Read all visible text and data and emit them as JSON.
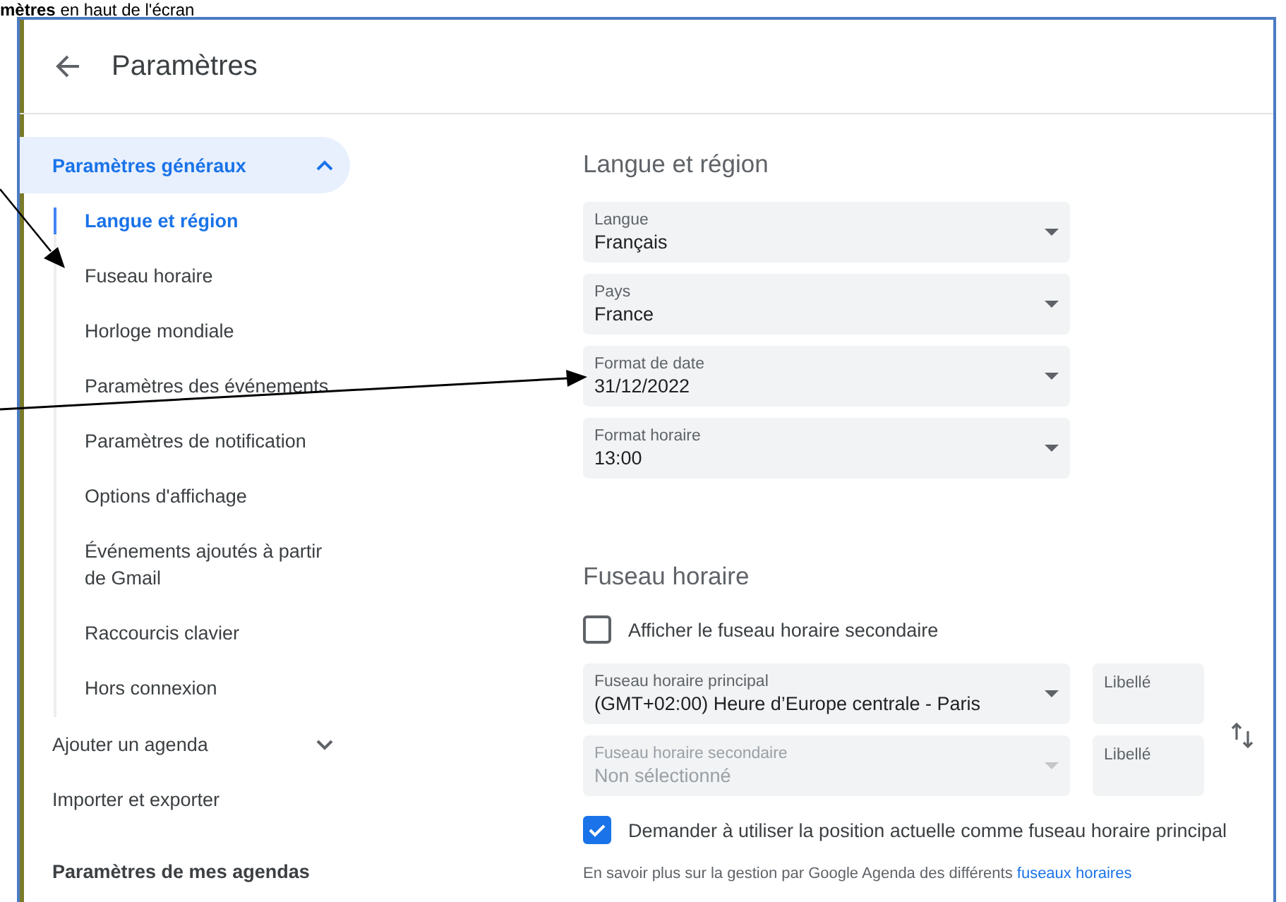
{
  "caption": "**mètres** en haut de l'écran",
  "header": {
    "title": "Paramètres"
  },
  "sidebar": {
    "items": [
      {
        "label": "Paramètres généraux",
        "kind": "group",
        "expanded": true,
        "selected": true,
        "children": [
          {
            "label": "Langue et région",
            "selected": true
          },
          {
            "label": "Fuseau horaire",
            "selected": false
          },
          {
            "label": "Horloge mondiale",
            "selected": false
          },
          {
            "label": "Paramètres des événements",
            "selected": false
          },
          {
            "label": "Paramètres de notification",
            "selected": false
          },
          {
            "label": "Options d'affichage",
            "selected": false
          },
          {
            "label": "Événements ajoutés à partir de Gmail",
            "selected": false
          },
          {
            "label": "Raccourcis clavier",
            "selected": false
          },
          {
            "label": "Hors connexion",
            "selected": false
          }
        ]
      },
      {
        "label": "Ajouter un agenda",
        "kind": "group",
        "expanded": false,
        "selected": false
      },
      {
        "label": "Importer et exporter",
        "kind": "link",
        "selected": false
      },
      {
        "label": "Paramètres de mes agendas",
        "kind": "heading",
        "selected": false
      }
    ]
  },
  "language_region": {
    "title": "Langue et région",
    "selects": [
      {
        "label": "Langue",
        "value": "Français"
      },
      {
        "label": "Pays",
        "value": "France"
      },
      {
        "label": "Format de date",
        "value": "31/12/2022"
      },
      {
        "label": "Format horaire",
        "value": "13:00"
      }
    ]
  },
  "time_zone": {
    "title": "Fuseau horaire",
    "show_secondary": {
      "label": "Afficher le fuseau horaire secondaire",
      "checked": false
    },
    "zones": [
      {
        "label": "Fuseau horaire principal",
        "value": "(GMT+02:00) Heure d’Europe centrale - Paris",
        "disabled": false,
        "name_field": {
          "placeholder": "Libellé"
        }
      },
      {
        "label": "Fuseau horaire secondaire",
        "value": "Non sélectionné",
        "disabled": true,
        "name_field": {
          "placeholder": "Libellé"
        }
      }
    ],
    "ask_location": {
      "label": "Demander à utiliser la position actuelle comme fuseau horaire principal",
      "checked": true
    },
    "note": {
      "text": "En savoir plus sur la gestion par Google Agenda des différents",
      "link": "fuseaux horaires"
    }
  }
}
